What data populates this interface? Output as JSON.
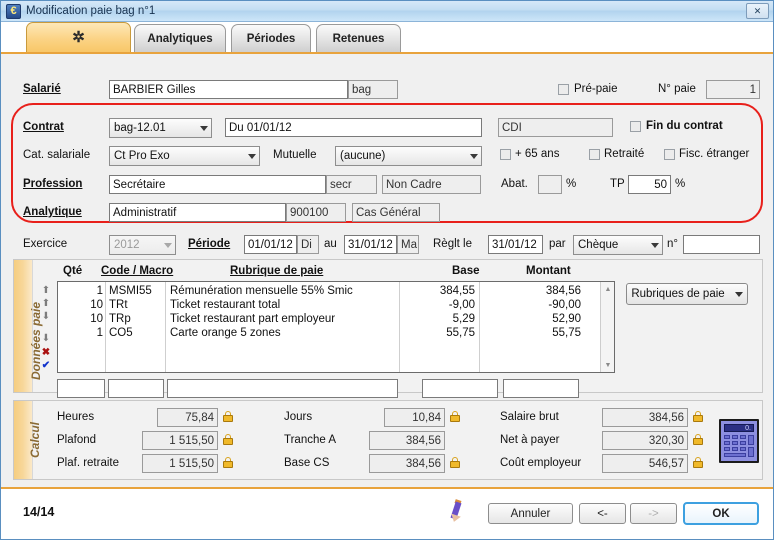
{
  "window": {
    "title": "Modification paie bag n°1",
    "app_icon": "euro-icon",
    "close_label": "✕"
  },
  "tabs": [
    {
      "label": "",
      "icon": "feather-icon",
      "active": true
    },
    {
      "label": "Analytiques",
      "active": false
    },
    {
      "label": "Périodes",
      "active": false
    },
    {
      "label": "Retenues",
      "active": false
    }
  ],
  "form": {
    "salarie_label": "Salarié",
    "salarie_value": "BARBIER Gilles",
    "salarie_code": "bag",
    "prepaie_label": "Pré-paie",
    "nopaie_label": "N° paie",
    "nopaie_value": "1",
    "contrat_label": "Contrat",
    "contrat_combo": "bag-12.01",
    "contrat_date": "Du 01/01/12",
    "contrat_type": "CDI",
    "fin_contrat_label": "Fin du contrat",
    "cat_salariale_label": "Cat. salariale",
    "cat_salariale_value": "Ct Pro Exo",
    "mutuelle_label": "Mutuelle",
    "mutuelle_value": "(aucune)",
    "plus65_label": "+ 65 ans",
    "retraite_label": "Retraité",
    "fisc_etranger_label": "Fisc. étranger",
    "profession_label": "Profession",
    "profession_value": "Secrétaire",
    "profession_code": "secr",
    "profession_cadre": "Non Cadre",
    "abat_label": "Abat.",
    "abat_value": "",
    "abat_pct": "%",
    "tp_label": "TP",
    "tp_value": "50",
    "tp_pct": "%",
    "analytique_label": "Analytique",
    "analytique_value": "Administratif",
    "analytique_code": "900100",
    "analytique_cas": "Cas Général",
    "exercice_label": "Exercice",
    "exercice_value": "2012",
    "periode_label": "Période",
    "periode_du": "01/01/12",
    "periode_du_jour": "Di",
    "au_label": "au",
    "periode_au": "31/01/12",
    "periode_au_jour": "Ma",
    "reglt_label": "Règlt le",
    "reglt_date": "31/01/12",
    "par_label": "par",
    "reglt_mode": "Chèque",
    "no_label": "n°",
    "no_value": ""
  },
  "donnees_paie": {
    "section_label": "Données paie",
    "columns": [
      "Qté",
      "Code / Macro",
      "Rubrique de paie",
      "Base",
      "Montant"
    ],
    "rows": [
      {
        "qte": "1",
        "code": "MSMI55",
        "rubrique": "Rémunération mensuelle 55% Smic",
        "base": "384,55",
        "montant": "384,56"
      },
      {
        "qte": "10",
        "code": "TRt",
        "rubrique": "Ticket restaurant total",
        "base": "-9,00",
        "montant": "-90,00"
      },
      {
        "qte": "10",
        "code": "TRp",
        "rubrique": "Ticket restaurant part employeur",
        "base": "5,29",
        "montant": "52,90"
      },
      {
        "qte": "1",
        "code": "CO5",
        "rubrique": "Carte orange 5 zones",
        "base": "55,75",
        "montant": "55,75"
      }
    ],
    "new_row": {
      "qte": "",
      "code": "",
      "rubrique": "",
      "base": "",
      "montant": ""
    },
    "rubriques_button": "Rubriques de paie",
    "nav_icons": [
      "arrow-up-first-icon",
      "arrow-up-icon",
      "arrow-down-icon",
      "arrow-down-last-icon",
      "delete-row-icon",
      "validate-row-icon"
    ]
  },
  "calcul": {
    "section_label": "Calcul",
    "fields": [
      {
        "label": "Heures",
        "value": "75,84",
        "locked": true
      },
      {
        "label": "Plafond",
        "value": "1 515,50",
        "locked": true
      },
      {
        "label": "Plaf. retraite",
        "value": "1 515,50",
        "locked": true
      },
      {
        "label": "Jours",
        "value": "10,84",
        "locked": true
      },
      {
        "label": "Tranche A",
        "value": "384,56",
        "locked": false
      },
      {
        "label": "Base CS",
        "value": "384,56",
        "locked": true
      },
      {
        "label": "Salaire brut",
        "value": "384,56",
        "locked": true
      },
      {
        "label": "Net à payer",
        "value": "320,30",
        "locked": true
      },
      {
        "label": "Coût employeur",
        "value": "546,57",
        "locked": true
      }
    ],
    "calculator_icon": "calculator-icon",
    "calculator_display": "0."
  },
  "footer": {
    "counter": "14/14",
    "edit_icon": "pencil-icon",
    "cancel": "Annuler",
    "prev": "<-",
    "next": "->",
    "ok": "OK"
  },
  "colors": {
    "accent": "#e8a33d",
    "highlight_box": "#e8201b",
    "titlebar": "#b2d3ee",
    "primary_button_border": "#3da0e0"
  }
}
